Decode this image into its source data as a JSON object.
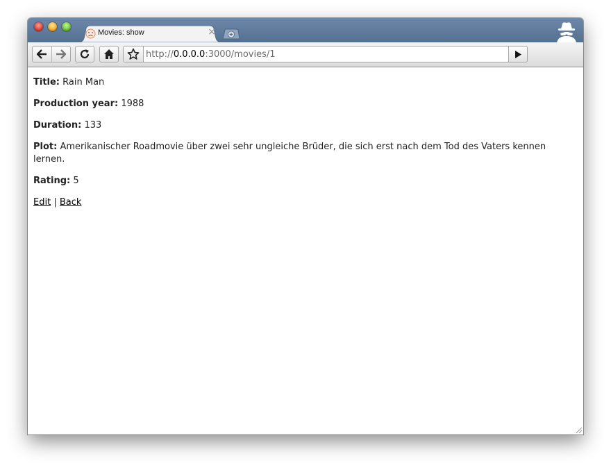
{
  "window": {
    "tab_title": "Movies: show",
    "address": {
      "scheme": "http://",
      "host": "0.0.0.0",
      "rest": ":3000/movies/1"
    }
  },
  "toolbar": {
    "icons": [
      "back-arrow-icon",
      "forward-arrow-icon",
      "reload-icon",
      "home-icon",
      "star-icon",
      "go-arrow-icon"
    ]
  },
  "movie": {
    "title_label": "Title:",
    "title_value": "Rain Man",
    "year_label": "Production year:",
    "year_value": "1988",
    "duration_label": "Duration:",
    "duration_value": "133",
    "plot_label": "Plot:",
    "plot_value": "Amerikanischer Roadmovie über zwei sehr ungleiche Brüder, die sich erst nach dem Tod des Vaters kennen lernen.",
    "rating_label": "Rating:",
    "rating_value": "5"
  },
  "links": {
    "edit": "Edit",
    "separator": "|",
    "back": "Back"
  },
  "colors": {
    "titlebar": "#5f7b9c",
    "toolbar": "#e6e6e6",
    "link": "#000000"
  }
}
